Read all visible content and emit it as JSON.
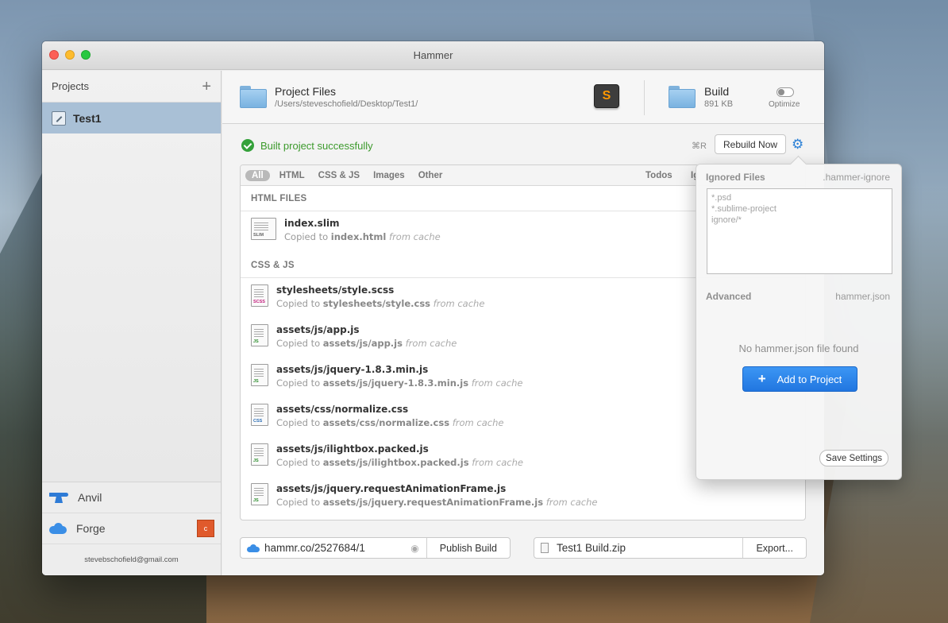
{
  "window": {
    "title": "Hammer"
  },
  "sidebar": {
    "header": "Projects",
    "add_symbol": "+",
    "projects": [
      {
        "name": "Test1"
      }
    ],
    "services": [
      {
        "name": "Anvil"
      },
      {
        "name": "Forge",
        "badge": "c"
      }
    ],
    "email": "stevebschofield@gmail.com"
  },
  "project_files": {
    "title": "Project Files",
    "path": "/Users/steveschofield/Desktop/Test1/",
    "editor_glyph": "S"
  },
  "build": {
    "title": "Build",
    "size": "891 KB",
    "optimize_label": "Optimize",
    "optimize_on": false
  },
  "status": {
    "message": "Built project successfully",
    "shortcut": "⌘R",
    "rebuild_label": "Rebuild Now"
  },
  "filters": {
    "items": [
      "All",
      "HTML",
      "CSS & JS",
      "Images",
      "Other"
    ],
    "active": "All",
    "right": [
      "Todos",
      "Ig"
    ]
  },
  "sections": [
    {
      "title": "HTML FILES",
      "files": [
        {
          "name": "index.slim",
          "copied_prefix": "Copied to",
          "target": "index.html",
          "note": "from cache",
          "type": "SLIM"
        }
      ]
    },
    {
      "title": "CSS & JS",
      "files": [
        {
          "name": "stylesheets/style.scss",
          "copied_prefix": "Copied to",
          "target": "stylesheets/style.css",
          "note": "from cache",
          "type": "SCSS"
        },
        {
          "name": "assets/js/app.js",
          "copied_prefix": "Copied to",
          "target": "assets/js/app.js",
          "note": "from cache",
          "type": "JS"
        },
        {
          "name": "assets/js/jquery-1.8.3.min.js",
          "copied_prefix": "Copied to",
          "target": "assets/js/jquery-1.8.3.min.js",
          "note": "from cache",
          "type": "JS"
        },
        {
          "name": "assets/css/normalize.css",
          "copied_prefix": "Copied to",
          "target": "assets/css/normalize.css",
          "note": "from cache",
          "type": "CSS"
        },
        {
          "name": "assets/js/ilightbox.packed.js",
          "copied_prefix": "Copied to",
          "target": "assets/js/ilightbox.packed.js",
          "note": "from cache",
          "type": "JS"
        },
        {
          "name": "assets/js/jquery.requestAnimationFrame.js",
          "copied_prefix": "Copied to",
          "target": "assets/js/jquery.requestAnimationFrame.js",
          "note": "from cache",
          "type": "JS"
        }
      ]
    }
  ],
  "bottom": {
    "url": "hammr.co/2527684/1",
    "publish_label": "Publish Build",
    "zip_name": "Test1 Build.zip",
    "export_label": "Export..."
  },
  "settings": {
    "ignored_label": "Ignored Files",
    "ignored_file": ".hammer-ignore",
    "ignored_placeholder": "*.psd\n*.sublime-project\nignore/*",
    "advanced_label": "Advanced",
    "advanced_file": "hammer.json",
    "no_file_text": "No hammer.json file found",
    "add_label": "Add to Project",
    "save_label": "Save Settings"
  },
  "colors": {
    "selection": "#a9c0d6",
    "accent": "#2176e0",
    "success": "#3c9a2c"
  }
}
